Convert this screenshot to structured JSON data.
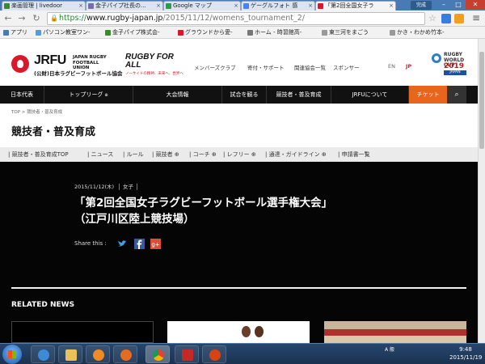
{
  "browser": {
    "tabs": [
      {
        "title": "楽画管理 | livedoor",
        "color": "#3b8a2e"
      },
      {
        "title": "金子パイプ社長の...",
        "color": "#7a6ab0"
      },
      {
        "title": "Google マップ",
        "color": "#2a9d48"
      },
      {
        "title": "ゲーグルフォト 感",
        "color": "#4285f4"
      },
      {
        "title": "「第2回全国女子ラ",
        "color": "#d9182c"
      }
    ],
    "user_badge": "完成",
    "minimize": "–",
    "maximize": "□",
    "close": "✕",
    "url_scheme": "https://",
    "url_host": "www.rugby-japan.jp",
    "url_path": "/2015/11/12/womens_tournament_2/",
    "bookmarks": [
      "アプリ",
      "パソコン教室ワン-",
      "金子パイプ株式会-",
      "グラウンドから愛-",
      "ホーム - 時習館高-",
      "東三河をまごう",
      "かき・わかめ竹本-"
    ]
  },
  "site": {
    "logo_main": "JRFU",
    "logo_en": "JAPAN RUGBY FOOTBALL UNION",
    "logo_jp": "(公財)日本ラグビーフットボール協会",
    "rfa_title": "RUGBY FOR ALL",
    "rfa_sub": "ノーサイドの精神、未来へ、世界へ",
    "header_links": [
      "メンバーズクラブ",
      "寄付・サポート",
      "関連協会一覧",
      "スポンサー"
    ],
    "lang_en": "EN",
    "lang_jp": "JP",
    "rwc_top": "RUGBY WORLD CUP",
    "rwc_year": "2019",
    "rwc_country": "JAPAN",
    "nav": [
      "日本代表",
      "トップリーグ",
      "大会情報",
      "試合を観る",
      "競技者・普及育成",
      "JRFUについて",
      "チケット"
    ],
    "breadcrumb": "TOP > 競技者・普及育成",
    "section_title": "競技者・普及育成",
    "subnav": [
      "競技者・普及育成TOP",
      "ニュース",
      "ルール",
      "競技者",
      "コーチ",
      "レフリー",
      "通達・ガイドライン",
      "申請書一覧"
    ]
  },
  "article": {
    "date": "2015/11/12(木)",
    "category": "女子",
    "headline_line1": "「第2回全国女子ラグビーフットボール選手権大会」",
    "headline_line2": "（江戸川区陸上競技場）",
    "share_label": "Share this :",
    "related_heading": "RELATED NEWS"
  },
  "taskbar": {
    "tray_text": "A 般",
    "time": "9:48",
    "date": "2015/11/19"
  }
}
